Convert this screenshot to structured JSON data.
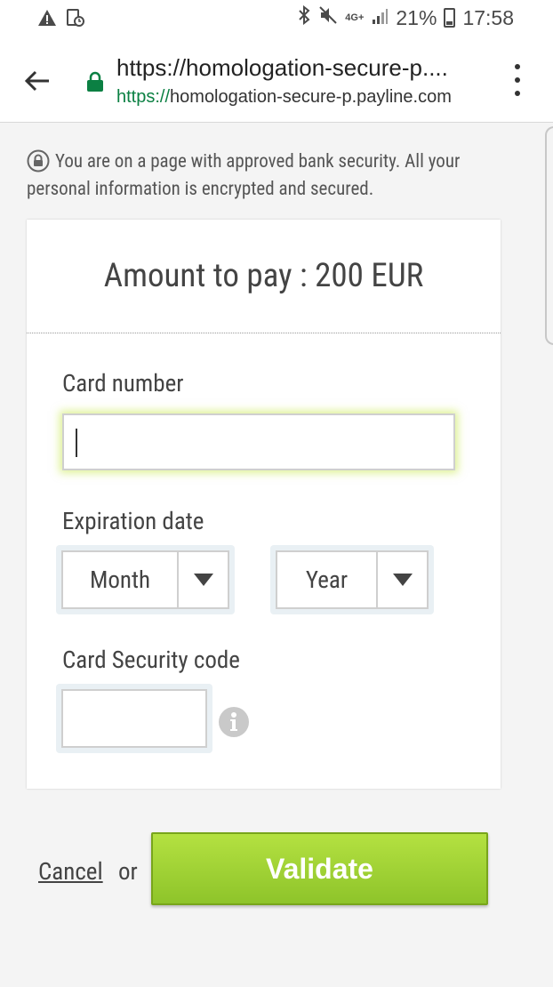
{
  "statusbar": {
    "left_icons": [
      "warning-icon",
      "screenshot-icon"
    ],
    "right_icons": [
      "bluetooth-icon",
      "mute-icon",
      "4g-signal-icon",
      "battery-icon"
    ],
    "network": "4G+",
    "battery": "21%",
    "time": "17:58"
  },
  "browser": {
    "title": "https://homologation-secure-p....",
    "url_scheme": "https://",
    "url_host": "homologation-secure-p.payline.com",
    "lock_color": "#0b8043"
  },
  "security_note": "You are on a page with approved bank security. All your personal information is encrypted and secured.",
  "payment": {
    "amount_text": "Amount to pay : 200 EUR"
  },
  "form": {
    "card_number_label": "Card number",
    "card_number_value": "",
    "expiration_label": "Expiration date",
    "month_value": "Month",
    "year_value": "Year",
    "cvv_label": "Card Security code",
    "cvv_value": ""
  },
  "actions": {
    "cancel_label": "Cancel",
    "or_text": "or",
    "validate_label": "Validate",
    "validate_color": "#9dd136"
  }
}
